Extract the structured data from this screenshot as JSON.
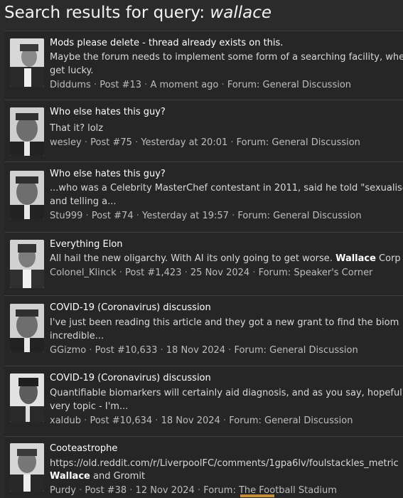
{
  "page": {
    "title_prefix": "Search results for query: ",
    "query": "wallace"
  },
  "results": [
    {
      "title": "Mods please delete - thread already exists on this.",
      "snippet": [
        "Maybe the forum needs to implement some form of a searching facility, where",
        "get lucky."
      ],
      "author": "Diddums",
      "post": "Post #13",
      "time": "A moment ago",
      "forum": "Forum: General Discussion"
    },
    {
      "title": "Who else hates this guy?",
      "snippet": [
        "That it? lolz"
      ],
      "author": "wesley",
      "post": "Post #75",
      "time": "Yesterday at 20:01",
      "forum": "Forum: General Discussion"
    },
    {
      "title": "Who else hates this guy?",
      "snippet": [
        "...who was a Celebrity MasterChef contestant in 2011, said he told \"sexualise",
        "and telling a..."
      ],
      "author": "Stu999",
      "post": "Post #74",
      "time": "Yesterday at 19:57",
      "forum": "Forum: General Discussion"
    },
    {
      "title": "Everything Elon",
      "snippet_pre": "All hail the new oligarchy. With AI its only going to get worse. ",
      "snippet_bold": "Wallace",
      "snippet_post": " Corp",
      "author": "Colonel_Klinck",
      "post": "Post #1,423",
      "time": "25 Nov 2024",
      "forum": "Forum: Speaker's Corner"
    },
    {
      "title": "COVID-19 (Coronavirus) discussion",
      "snippet": [
        "I've just been reading this article and they got a new grant to find the biom",
        "incredible..."
      ],
      "author": "GGizmo",
      "post": "Post #10,633",
      "time": "18 Nov 2024",
      "forum": "Forum: General Discussion"
    },
    {
      "title": "COVID-19 (Coronavirus) discussion",
      "snippet": [
        "Quantifiable biomarkers will certainly aid diagnosis, and as you say, hopeful",
        "very topic - I'm..."
      ],
      "author": "xaldub",
      "post": "Post #10,634",
      "time": "18 Nov 2024",
      "forum": "Forum: General Discussion"
    },
    {
      "title": "Cooteastrophe",
      "snippet": [
        "https://old.reddit.com/r/LiverpoolFC/comments/1gpa6lv/foulstackles_metric"
      ],
      "snippet2_bold": "Wallace",
      "snippet2_post": " and Gromit",
      "author": "Purdy",
      "post": "Post #38",
      "time": "12 Nov 2024",
      "forum": "Forum: The Football Stadium"
    }
  ],
  "separator": "·",
  "colors": {
    "background": "#2b2b2b",
    "panel": "#262626",
    "divider": "#3f3f3f",
    "title_text": "#ffffff",
    "meta_text": "#bdbdbd",
    "highlight": "#c98b3c"
  }
}
